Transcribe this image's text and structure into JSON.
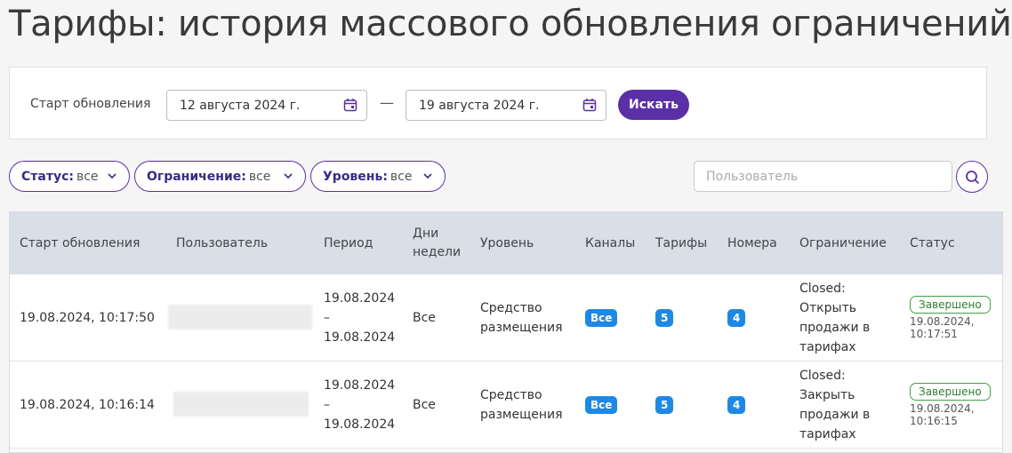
{
  "page": {
    "title": "Тарифы: история массового обновления ограничений"
  },
  "filters": {
    "start_label": "Старт обновления",
    "date_from": "12 августа 2024 г.",
    "date_to": "19 августа 2024 г.",
    "dash": "—",
    "search_button": "Искать",
    "chips": [
      {
        "label": "Статус:",
        "value": "все"
      },
      {
        "label": "Ограничение:",
        "value": "все"
      },
      {
        "label": "Уровень:",
        "value": "все"
      }
    ],
    "user_placeholder": "Пользователь"
  },
  "table": {
    "headers": [
      "Старт обновления",
      "Пользователь",
      "Период",
      "Дни недели",
      "Уровень",
      "Каналы",
      "Тарифы",
      "Номера",
      "Ограничение",
      "Статус"
    ],
    "rows": [
      {
        "start": "19.08.2024, 10:17:50",
        "user": "",
        "period": "19.08.2024 – 19.08.2024",
        "days": "Все",
        "level": "Средство размещения",
        "channels": "Все",
        "tariffs": "5",
        "rooms": "4",
        "restriction": "Closed: Открыть продажи в тарифах",
        "status": "Завершено",
        "status_time": "19.08.2024, 10:17:51"
      },
      {
        "start": "19.08.2024, 10:16:14",
        "user": "",
        "period": "19.08.2024 – 19.08.2024",
        "days": "Все",
        "level": "Средство размещения",
        "channels": "Все",
        "tariffs": "5",
        "rooms": "4",
        "restriction": "Closed: Закрыть продажи в тарифах",
        "status": "Завершено",
        "status_time": "19.08.2024, 10:16:15"
      }
    ]
  },
  "icons": {
    "calendar": "calendar-icon",
    "chevron": "chevron-down-icon",
    "search": "search-icon"
  },
  "colors": {
    "accent": "#5b2fa6",
    "badge_blue": "#1e88e5",
    "status_green": "#43a047",
    "header_bg": "#d9dee7"
  }
}
